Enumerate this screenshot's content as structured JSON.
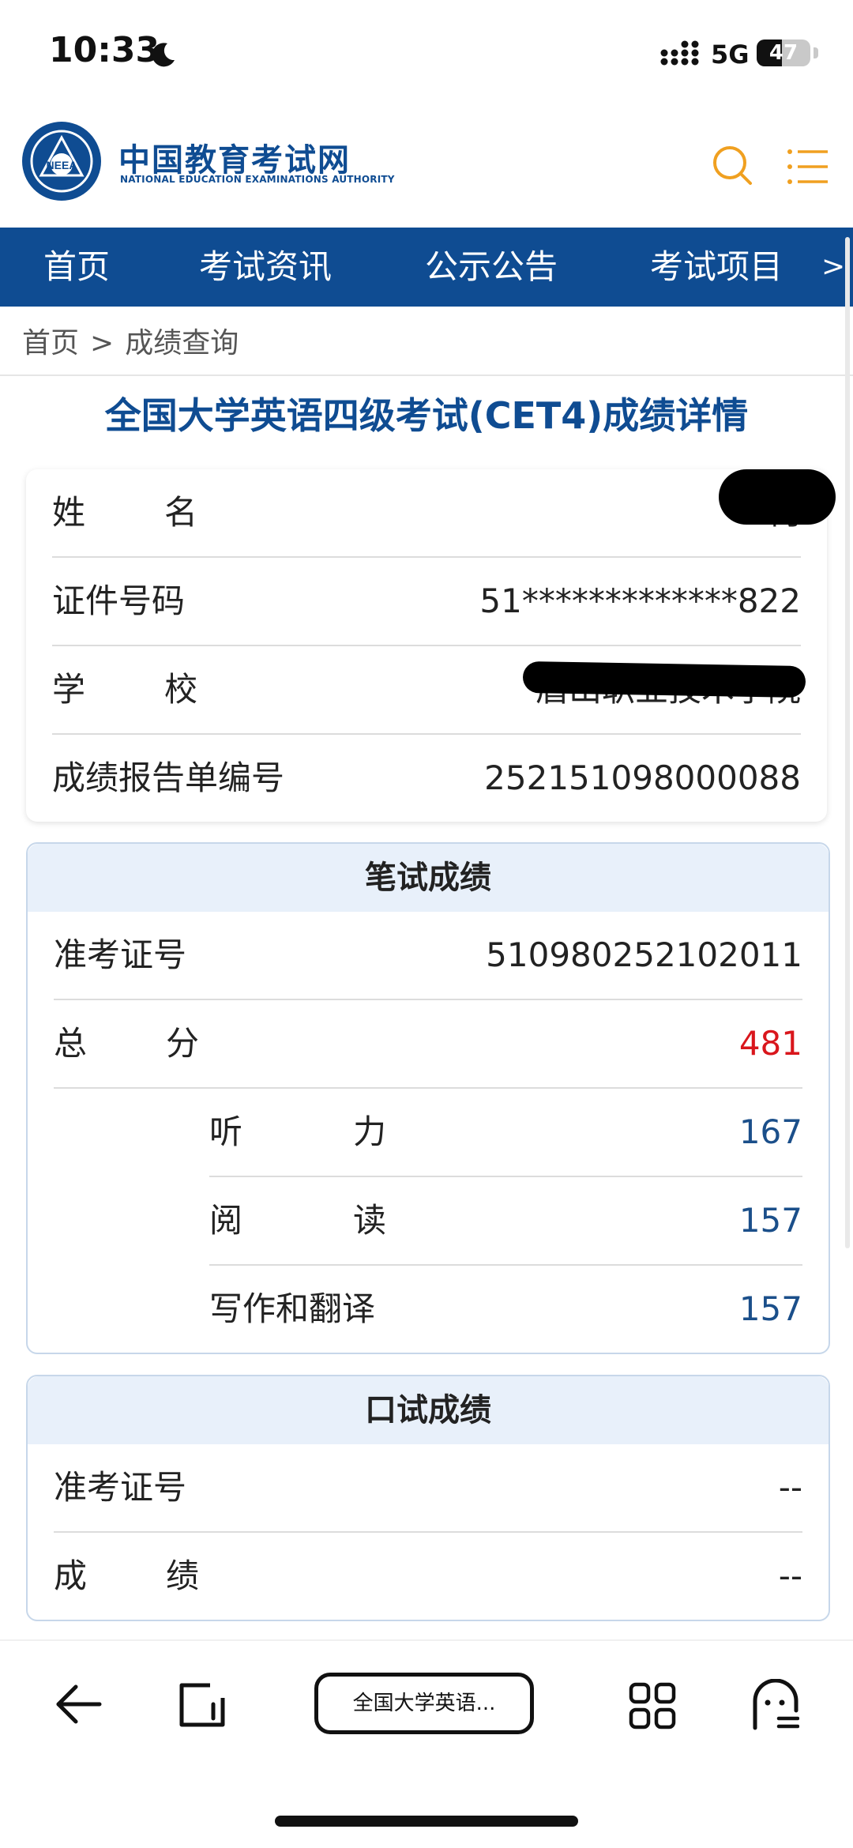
{
  "status_bar": {
    "time": "10:33",
    "network": "5G",
    "battery": "47",
    "battery_level_percent": 47
  },
  "header": {
    "site_name": "中国教育考试网",
    "site_name_en": "NATIONAL EDUCATION EXAMINATIONS AUTHORITY",
    "logo_letters": "NEEA"
  },
  "nav": {
    "items": [
      "首页",
      "考试资讯",
      "公示公告",
      "考试项目"
    ],
    "more": ">"
  },
  "breadcrumb": {
    "home": "首页",
    "separator": ">",
    "current": "成绩查询"
  },
  "page_title": "全国大学英语四级考试(CET4)成绩详情",
  "personal_info": {
    "rows": [
      {
        "label_a": "姓",
        "label_b": "名",
        "value": "何"
      },
      {
        "label": "证件号码",
        "value": "51*************822"
      },
      {
        "label_a": "学",
        "label_b": "校",
        "value": "眉山职业技术学院"
      },
      {
        "label": "成绩报告单编号",
        "value": "252151098000088"
      }
    ]
  },
  "written": {
    "heading": "笔试成绩",
    "ticket_label": "准考证号",
    "ticket_value": "510980252102011",
    "total_label_a": "总",
    "total_label_b": "分",
    "total_value": "481",
    "parts": [
      {
        "label_a": "听",
        "label_b": "力",
        "value": "167"
      },
      {
        "label_a": "阅",
        "label_b": "读",
        "value": "157"
      },
      {
        "label": "写作和翻译",
        "value": "157"
      }
    ]
  },
  "oral": {
    "heading": "口试成绩",
    "ticket_label": "准考证号",
    "ticket_value": "--",
    "score_label_a": "成",
    "score_label_b": "绩",
    "score_value": "--"
  },
  "browser": {
    "tab_title": "全国大学英语..."
  },
  "colors": {
    "brand_blue": "#0f4c92",
    "header_orange": "#f0a020",
    "score_red": "#d9161c",
    "score_blue": "#1b4f8a",
    "section_head_bg": "#e8f0fa"
  }
}
